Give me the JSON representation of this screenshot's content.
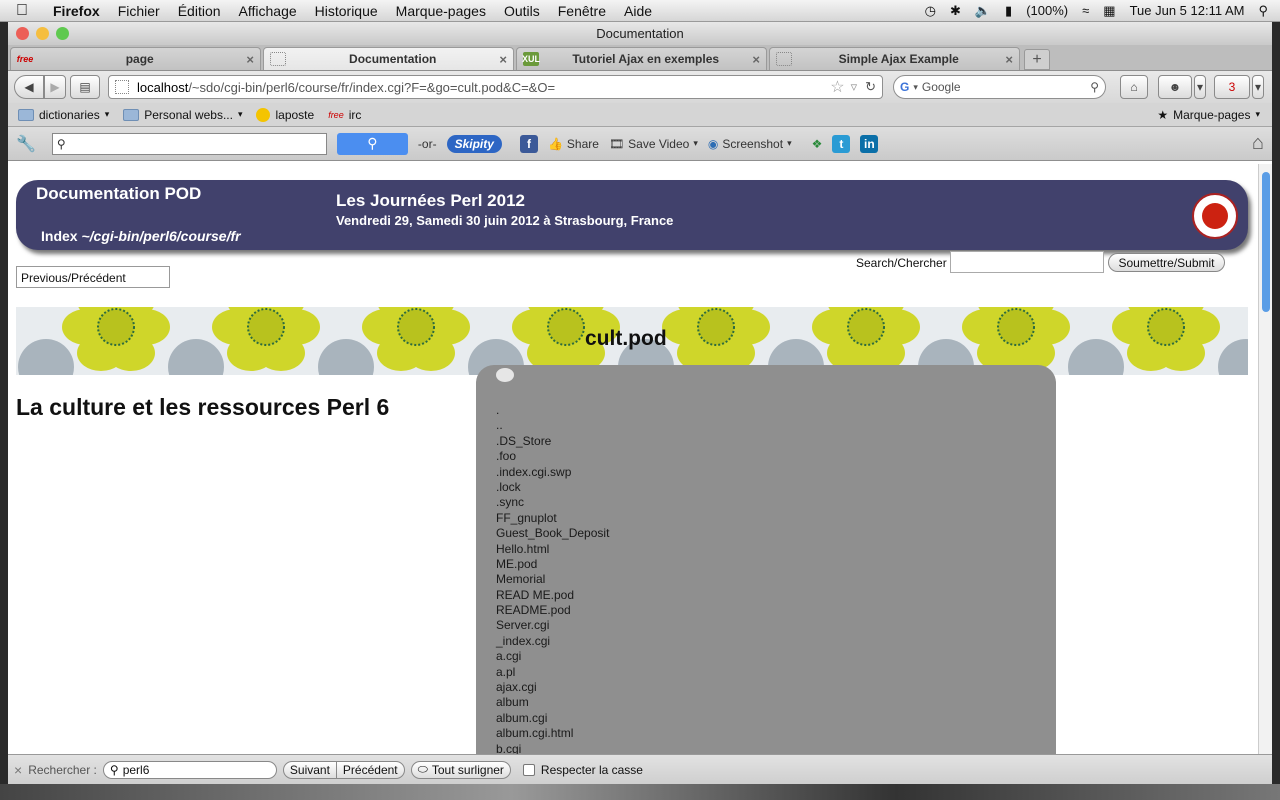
{
  "menubar": {
    "apple": "",
    "items": [
      "Firefox",
      "Fichier",
      "Édition",
      "Affichage",
      "Historique",
      "Marque-pages",
      "Outils",
      "Fenêtre",
      "Aide"
    ],
    "battery": "(100%)",
    "clock": "Tue Jun 5  12:11 AM"
  },
  "window": {
    "title": "Documentation"
  },
  "tabs": [
    {
      "label": "page",
      "favicon": "free"
    },
    {
      "label": "Documentation",
      "favicon": ""
    },
    {
      "label": "Tutoriel Ajax en exemples",
      "favicon": "XUL"
    },
    {
      "label": "Simple Ajax Example",
      "favicon": ""
    }
  ],
  "tab_close": "×",
  "new_tab": "+",
  "nav": {
    "url_host": "localhost",
    "url_path": "/~sdo/cgi-bin/perl6/course/fr/index.cgi?F=&go=cult.pod&C=&O=",
    "search_engine": "Google",
    "addon_badge": "3"
  },
  "bookmarks": {
    "items": [
      "dictionaries",
      "Personal webs...",
      "laposte",
      "irc"
    ],
    "right": "Marque-pages"
  },
  "toolbar2": {
    "or": "-or-",
    "skipity": "Skipity",
    "share": "Share",
    "save_video": "Save Video",
    "screenshot": "Screenshot"
  },
  "page": {
    "header_title": "Documentation POD",
    "header_index_prefix": "Index ",
    "header_index_path": "~/cgi-bin/perl6/course/fr",
    "event_title": "Les Journées Perl 2012",
    "event_date": "Vendredi 29, Samedi 30 juin 2012 à Strasbourg, France",
    "previous": "Previous/Précédent",
    "search_label": "Search/Chercher",
    "submit": "Soumettre/Submit",
    "doc_title": "cult.pod",
    "heading": "La culture et les ressources Perl 6",
    "files": [
      ".",
      "..",
      ".DS_Store",
      ".foo",
      ".index.cgi.swp",
      ".lock",
      ".sync",
      "FF_gnuplot",
      "Guest_Book_Deposit",
      "Hello.html",
      "ME.pod",
      "Memorial",
      "READ ME.pod",
      "README.pod",
      "Server.cgi",
      "_index.cgi",
      "a.cgi",
      "a.pl",
      "ajax.cgi",
      "album",
      "album.cgi",
      "album.cgi.html",
      "b.cgi"
    ]
  },
  "findbar": {
    "close": "×",
    "label": "Rechercher :",
    "value": "perl6",
    "next": "Suivant",
    "prev": "Précédent",
    "highlight": "Tout surligner",
    "match_case": "Respecter la casse"
  }
}
